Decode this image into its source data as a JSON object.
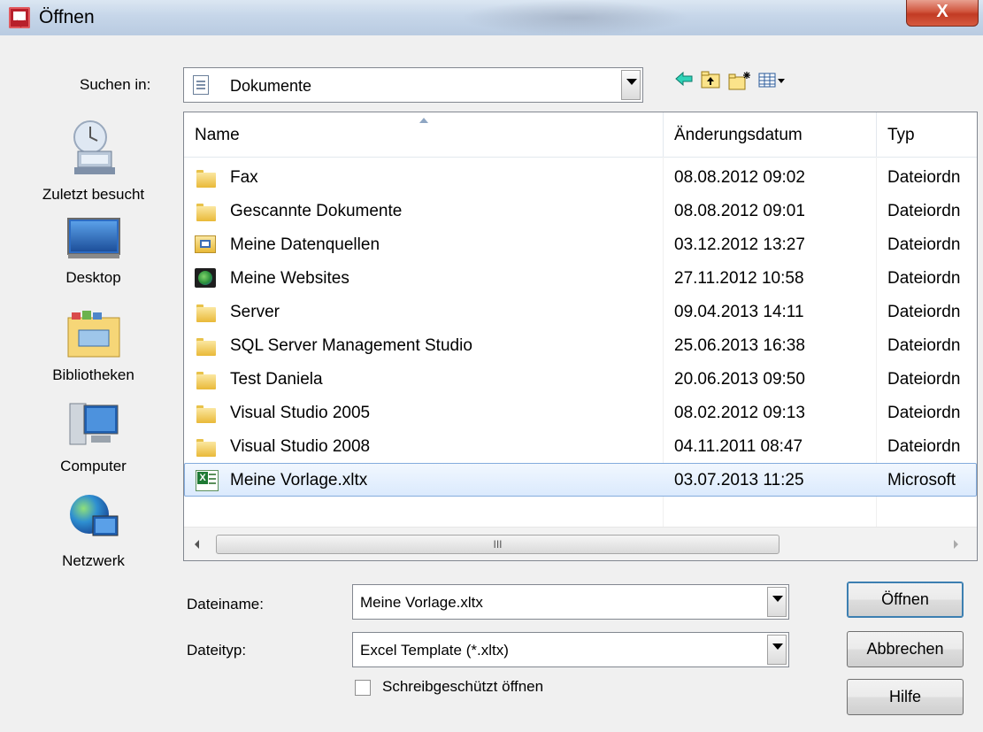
{
  "window": {
    "title": "Öffnen",
    "close_label": "X"
  },
  "lookin": {
    "label": "Suchen in:",
    "value": "Dokumente"
  },
  "toolbar": {
    "back_icon": "back-arrow-icon",
    "up_icon": "up-folder-icon",
    "new_folder_icon": "new-folder-icon",
    "views_icon": "view-menu-icon"
  },
  "places": [
    {
      "label": "Zuletzt besucht",
      "icon": "recent-places-icon"
    },
    {
      "label": "Desktop",
      "icon": "desktop-icon"
    },
    {
      "label": "Bibliotheken",
      "icon": "libraries-icon"
    },
    {
      "label": "Computer",
      "icon": "computer-icon"
    },
    {
      "label": "Netzwerk",
      "icon": "network-icon"
    }
  ],
  "filelist": {
    "columns": [
      "Name",
      "Änderungsdatum",
      "Typ"
    ],
    "rows": [
      {
        "name": "Fax",
        "date": "08.08.2012 09:02",
        "type": "Dateiordn",
        "icon": "folder-icon"
      },
      {
        "name": "Gescannte Dokumente",
        "date": "08.08.2012 09:01",
        "type": "Dateiordn",
        "icon": "folder-icon"
      },
      {
        "name": "Meine Datenquellen",
        "date": "03.12.2012 13:27",
        "type": "Dateiordn",
        "icon": "special-folder-icon"
      },
      {
        "name": "Meine Websites",
        "date": "27.11.2012 10:58",
        "type": "Dateiordn",
        "icon": "web-folder-icon"
      },
      {
        "name": "Server",
        "date": "09.04.2013 14:11",
        "type": "Dateiordn",
        "icon": "folder-icon"
      },
      {
        "name": "SQL Server Management Studio",
        "date": "25.06.2013 16:38",
        "type": "Dateiordn",
        "icon": "folder-icon"
      },
      {
        "name": "Test Daniela",
        "date": "20.06.2013 09:50",
        "type": "Dateiordn",
        "icon": "folder-icon"
      },
      {
        "name": "Visual Studio 2005",
        "date": "08.02.2012 09:13",
        "type": "Dateiordn",
        "icon": "folder-icon"
      },
      {
        "name": "Visual Studio 2008",
        "date": "04.11.2011 08:47",
        "type": "Dateiordn",
        "icon": "folder-icon"
      },
      {
        "name": "Meine Vorlage.xltx",
        "date": "03.07.2013 11:25",
        "type": "Microsoft",
        "icon": "excel-file-icon",
        "selected": true
      }
    ],
    "scroll_thumb_label": "III"
  },
  "filename": {
    "label": "Dateiname:",
    "value": "Meine Vorlage.xltx"
  },
  "filetype": {
    "label": "Dateityp:",
    "value": "Excel Template (*.xltx)"
  },
  "readonly": {
    "label": "Schreibgeschützt öffnen",
    "checked": false
  },
  "buttons": {
    "open": "Öffnen",
    "cancel": "Abbrechen",
    "help": "Hilfe"
  }
}
